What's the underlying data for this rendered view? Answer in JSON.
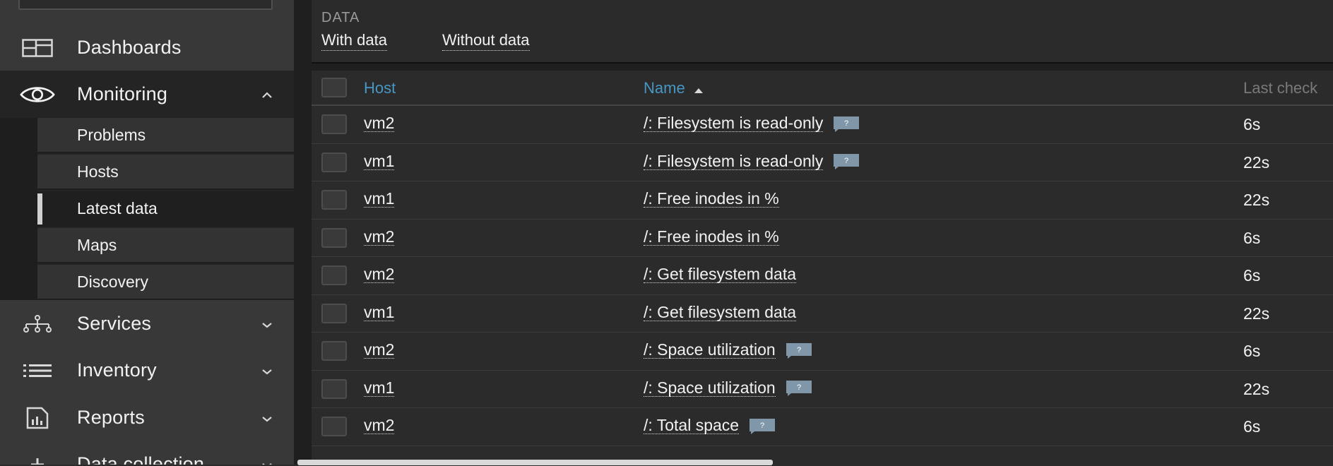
{
  "sidebar": {
    "search": {
      "icon": "search-icon"
    },
    "menu": {
      "dashboards": {
        "label": "Dashboards",
        "icon": "dashboard-grid-icon"
      },
      "monitoring": {
        "label": "Monitoring",
        "icon": "eye-icon",
        "expanded": true
      },
      "services": {
        "label": "Services",
        "icon": "services-tree-icon"
      },
      "inventory": {
        "label": "Inventory",
        "icon": "list-icon"
      },
      "reports": {
        "label": "Reports",
        "icon": "report-chart-icon"
      },
      "data_collection": {
        "label": "Data collection",
        "icon": "plus-icon"
      }
    },
    "submenu": {
      "problems": "Problems",
      "hosts": "Hosts",
      "latest_data": "Latest data",
      "maps": "Maps",
      "discovery": "Discovery"
    },
    "active_submenu": "Latest data"
  },
  "filter": {
    "title": "DATA",
    "options": {
      "with_data": "With data",
      "without_data": "Without data"
    }
  },
  "table": {
    "columns": {
      "host": "Host",
      "name": "Name",
      "last_check": "Last check"
    },
    "sort": {
      "column": "Name",
      "direction": "ascending"
    },
    "rows": [
      {
        "host": "vm2",
        "name": "/: Filesystem is read-only",
        "has_description": true,
        "last_check": "6s"
      },
      {
        "host": "vm1",
        "name": "/: Filesystem is read-only",
        "has_description": true,
        "last_check": "22s"
      },
      {
        "host": "vm1",
        "name": "/: Free inodes in %",
        "has_description": false,
        "last_check": "22s"
      },
      {
        "host": "vm2",
        "name": "/: Free inodes in %",
        "has_description": false,
        "last_check": "6s"
      },
      {
        "host": "vm2",
        "name": "/: Get filesystem data",
        "has_description": false,
        "last_check": "6s"
      },
      {
        "host": "vm1",
        "name": "/: Get filesystem data",
        "has_description": false,
        "last_check": "22s"
      },
      {
        "host": "vm2",
        "name": "/: Space utilization",
        "has_description": true,
        "last_check": "6s"
      },
      {
        "host": "vm1",
        "name": "/: Space utilization",
        "has_description": true,
        "last_check": "22s"
      },
      {
        "host": "vm2",
        "name": "/: Total space",
        "has_description": true,
        "last_check": "6s"
      }
    ],
    "description_badge": "?"
  },
  "colors": {
    "link_blue": "#4796c4",
    "badge": "#7f97a8",
    "sidebar_bg": "#383838",
    "page_bg": "#1f1f1f",
    "panel_bg": "#2b2b2b"
  }
}
